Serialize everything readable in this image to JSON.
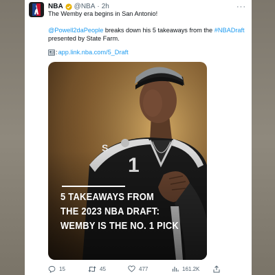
{
  "tweet": {
    "display_name": "NBA",
    "handle": "@NBA",
    "separator": "·",
    "time": "2h",
    "more": "···",
    "line1": "The Wemby era begins in San Antonio!",
    "mention": "@Powell2daPeople",
    "line2_rest": " breaks down his 5 takeaways from the ",
    "hashtag": "#NBADraft",
    "line3": "presented by State Farm.",
    "link_prefix": ":",
    "link": "app.link.nba.com/5_Draft"
  },
  "media": {
    "headline": [
      "5 TAKEAWAYS FROM",
      "THE 2023 NBA DRAFT:",
      "WEMBY IS THE NO. 1 PICK"
    ],
    "jersey_number": "1",
    "jersey_text": "S"
  },
  "actions": {
    "replies": "15",
    "retweets": "45",
    "likes": "477",
    "views": "161.2K"
  },
  "colors": {
    "accent": "#1d9bf0",
    "verified": "#e8b100",
    "text": "#0f1419",
    "muted": "#536471"
  }
}
